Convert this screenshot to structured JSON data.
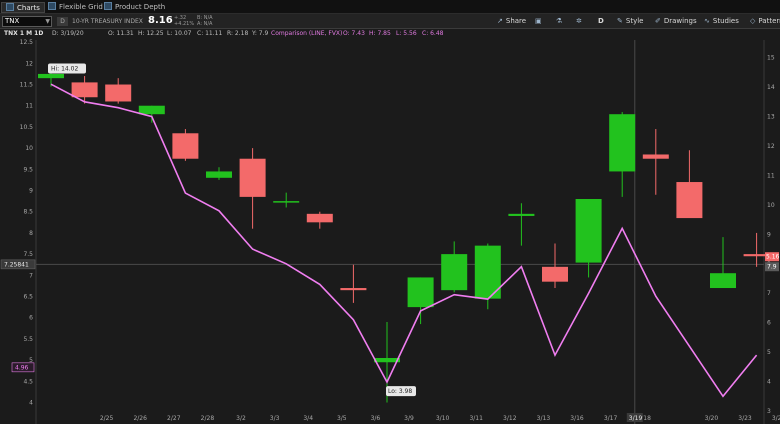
{
  "tabs": [
    {
      "label": "Charts",
      "active": true
    },
    {
      "label": "Flexible Grid",
      "active": false
    },
    {
      "label": "Product Depth",
      "active": false
    }
  ],
  "toolbar": {
    "symbol": "TNX",
    "badge": "D",
    "description": "10-YR TREASURY INDEX",
    "last": "8.16",
    "change": "+.32",
    "change_pct": "+4.21%",
    "bid": "B: N/A",
    "ask": "A: N/A",
    "share_label": "Share",
    "period_label": "D",
    "style_label": "Style",
    "drawings_label": "Drawings",
    "studies_label": "Studies",
    "patterns_label": "Patterns"
  },
  "info": {
    "symbol": "TNX 1 M 1D",
    "date": "D: 3/19/20",
    "open": "O: 11.31",
    "high": "H: 12.25",
    "low": "L: 10.07",
    "close": "C: 11.11",
    "range": "R: 2.18",
    "last": "Y: 7.9",
    "comparison": "Comparison (LINE, FVX)",
    "cmp_open": "O: 7.43",
    "cmp_high": "H: 7.85",
    "cmp_low": "L: 5.56",
    "cmp_close": "C: 6.48"
  },
  "markers": {
    "high_label": "Hi: 14.02",
    "low_label": "Lo: 3.98",
    "crosshair_price": "7.25841",
    "last_price_tag": "7.9",
    "right_tag": "5.16",
    "comparison_tag": "4.96",
    "crosshair_date": "3/19"
  },
  "colors": {
    "up": "#22c21e",
    "down": "#f36a6a",
    "comparison": "#f07ef0",
    "background": "#1b1b1b"
  },
  "chart_data": {
    "type": "candlestick",
    "categories": [
      "2/24",
      "2/25",
      "2/26",
      "2/27",
      "2/28",
      "3/2",
      "3/3",
      "3/4",
      "3/5",
      "3/6",
      "3/9",
      "3/10",
      "3/11",
      "3/12",
      "3/13",
      "3/16",
      "3/17",
      "3/18",
      "3/19",
      "3/20",
      "3/23",
      "3/24"
    ],
    "x_tick_labels": [
      "2/25",
      "2/26",
      "2/27",
      "2/28",
      "3/2",
      "3/3",
      "3/4",
      "3/5",
      "3/6",
      "3/9",
      "3/10",
      "3/11",
      "3/12",
      "3/13",
      "3/16",
      "3/17",
      "3/18",
      "3/19",
      "3/20",
      "3/23",
      "3/24"
    ],
    "ohlc": [
      {
        "o": 11.65,
        "h": 11.8,
        "l": 11.45,
        "c": 11.75
      },
      {
        "o": 11.55,
        "h": 11.7,
        "l": 11.05,
        "c": 11.2
      },
      {
        "o": 11.5,
        "h": 11.65,
        "l": 11.05,
        "c": 11.1
      },
      {
        "o": 10.8,
        "h": 11.0,
        "l": 10.6,
        "c": 11.0
      },
      {
        "o": 10.35,
        "h": 10.45,
        "l": 9.7,
        "c": 9.75
      },
      {
        "o": 9.3,
        "h": 9.55,
        "l": 9.25,
        "c": 9.45
      },
      {
        "o": 9.75,
        "h": 10.0,
        "l": 8.1,
        "c": 8.85
      },
      {
        "o": 8.75,
        "h": 8.95,
        "l": 8.6,
        "c": 8.75
      },
      {
        "o": 8.45,
        "h": 8.5,
        "l": 8.1,
        "c": 8.25
      },
      {
        "o": 6.7,
        "h": 7.25,
        "l": 6.35,
        "c": 6.65
      },
      {
        "o": 4.95,
        "h": 5.9,
        "l": 4.0,
        "c": 5.05
      },
      {
        "o": 6.25,
        "h": 6.95,
        "l": 5.85,
        "c": 6.95
      },
      {
        "o": 6.65,
        "h": 7.8,
        "l": 6.6,
        "c": 7.5
      },
      {
        "o": 6.45,
        "h": 7.75,
        "l": 6.2,
        "c": 7.7
      },
      {
        "o": 8.4,
        "h": 8.7,
        "l": 7.7,
        "c": 8.45
      },
      {
        "o": 7.2,
        "h": 7.75,
        "l": 6.7,
        "c": 6.85
      },
      {
        "o": 7.3,
        "h": 8.8,
        "l": 6.95,
        "c": 8.8
      },
      {
        "o": 9.45,
        "h": 10.85,
        "l": 8.85,
        "c": 10.8
      },
      {
        "o": 9.85,
        "h": 10.45,
        "l": 8.9,
        "c": 9.75
      },
      {
        "o": 9.2,
        "h": 9.95,
        "l": 8.45,
        "c": 8.35
      },
      {
        "o": 6.7,
        "h": 7.9,
        "l": 6.7,
        "c": 7.05
      },
      {
        "o": 7.5,
        "h": 8.0,
        "l": 7.2,
        "c": 7.45
      }
    ],
    "comparison_series": {
      "name": "FVX",
      "values": [
        14.1,
        13.5,
        13.3,
        13.0,
        10.4,
        9.8,
        8.5,
        8.0,
        7.3,
        6.1,
        3.98,
        6.4,
        6.95,
        6.8,
        7.9,
        4.9,
        7.0,
        9.2,
        6.9,
        5.2,
        3.5,
        4.9
      ]
    },
    "left_axis": {
      "min": 3.8,
      "max": 12.55,
      "ticks": [
        "12.5",
        "12",
        "11.5",
        "11",
        "10.5",
        "10",
        "9.5",
        "9",
        "8.5",
        "8",
        "7.5",
        "7",
        "6.5",
        "6",
        "5.5",
        "5",
        "4.5",
        "4"
      ]
    },
    "right_axis": {
      "min": 3.0,
      "max": 15.6,
      "ticks": [
        "15",
        "14",
        "13",
        "12",
        "11",
        "10",
        "9",
        "8",
        "7",
        "6",
        "5",
        "4",
        "3"
      ]
    },
    "grid": false
  }
}
